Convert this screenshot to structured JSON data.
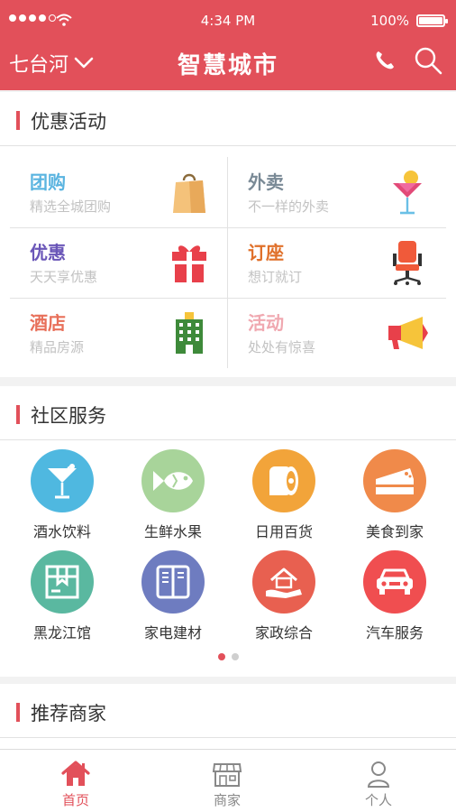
{
  "status_bar": {
    "time": "4:34 PM",
    "battery": "100%",
    "battery_level": 1.0
  },
  "nav": {
    "city": "七台河",
    "title": "智慧城市"
  },
  "colors": {
    "brand": "#e2505a"
  },
  "promotions": {
    "title": "优惠活动",
    "items": [
      {
        "title": "团购",
        "subtitle": "精选全城团购",
        "color": "#5ab4e0",
        "icon": "shopping-bag-icon"
      },
      {
        "title": "外卖",
        "subtitle": "不一样的外卖",
        "color": "#7a8a96",
        "icon": "cocktail-icon"
      },
      {
        "title": "优惠",
        "subtitle": "天天享优惠",
        "color": "#6a56b8",
        "icon": "gift-icon"
      },
      {
        "title": "订座",
        "subtitle": "想订就订",
        "color": "#e0702a",
        "icon": "chair-icon"
      },
      {
        "title": "酒店",
        "subtitle": "精品房源",
        "color": "#e8705a",
        "icon": "hotel-icon"
      },
      {
        "title": "活动",
        "subtitle": "处处有惊喜",
        "color": "#f0a8b0",
        "icon": "megaphone-icon"
      }
    ]
  },
  "community": {
    "title": "社区服务",
    "items": [
      {
        "label": "酒水饮料",
        "color": "#4fb8e0",
        "icon": "cocktail-glass-icon"
      },
      {
        "label": "生鲜水果",
        "color": "#a8d49a",
        "icon": "fish-icon"
      },
      {
        "label": "日用百货",
        "color": "#f2a43a",
        "icon": "toilet-paper-icon"
      },
      {
        "label": "美食到家",
        "color": "#f08a4a",
        "icon": "cake-icon"
      },
      {
        "label": "黑龙江馆",
        "color": "#5ab8a0",
        "icon": "package-icon"
      },
      {
        "label": "家电建材",
        "color": "#6e7cc0",
        "icon": "refrigerator-icon"
      },
      {
        "label": "家政综合",
        "color": "#e86050",
        "icon": "house-hand-icon"
      },
      {
        "label": "汽车服务",
        "color": "#f04e50",
        "icon": "car-icon"
      }
    ],
    "page": 1,
    "page_count": 2
  },
  "recommend": {
    "title": "推荐商家"
  },
  "tabs": [
    {
      "label": "首页",
      "icon": "home-icon",
      "active": true
    },
    {
      "label": "商家",
      "icon": "storefront-icon",
      "active": false
    },
    {
      "label": "个人",
      "icon": "person-icon",
      "active": false
    }
  ]
}
